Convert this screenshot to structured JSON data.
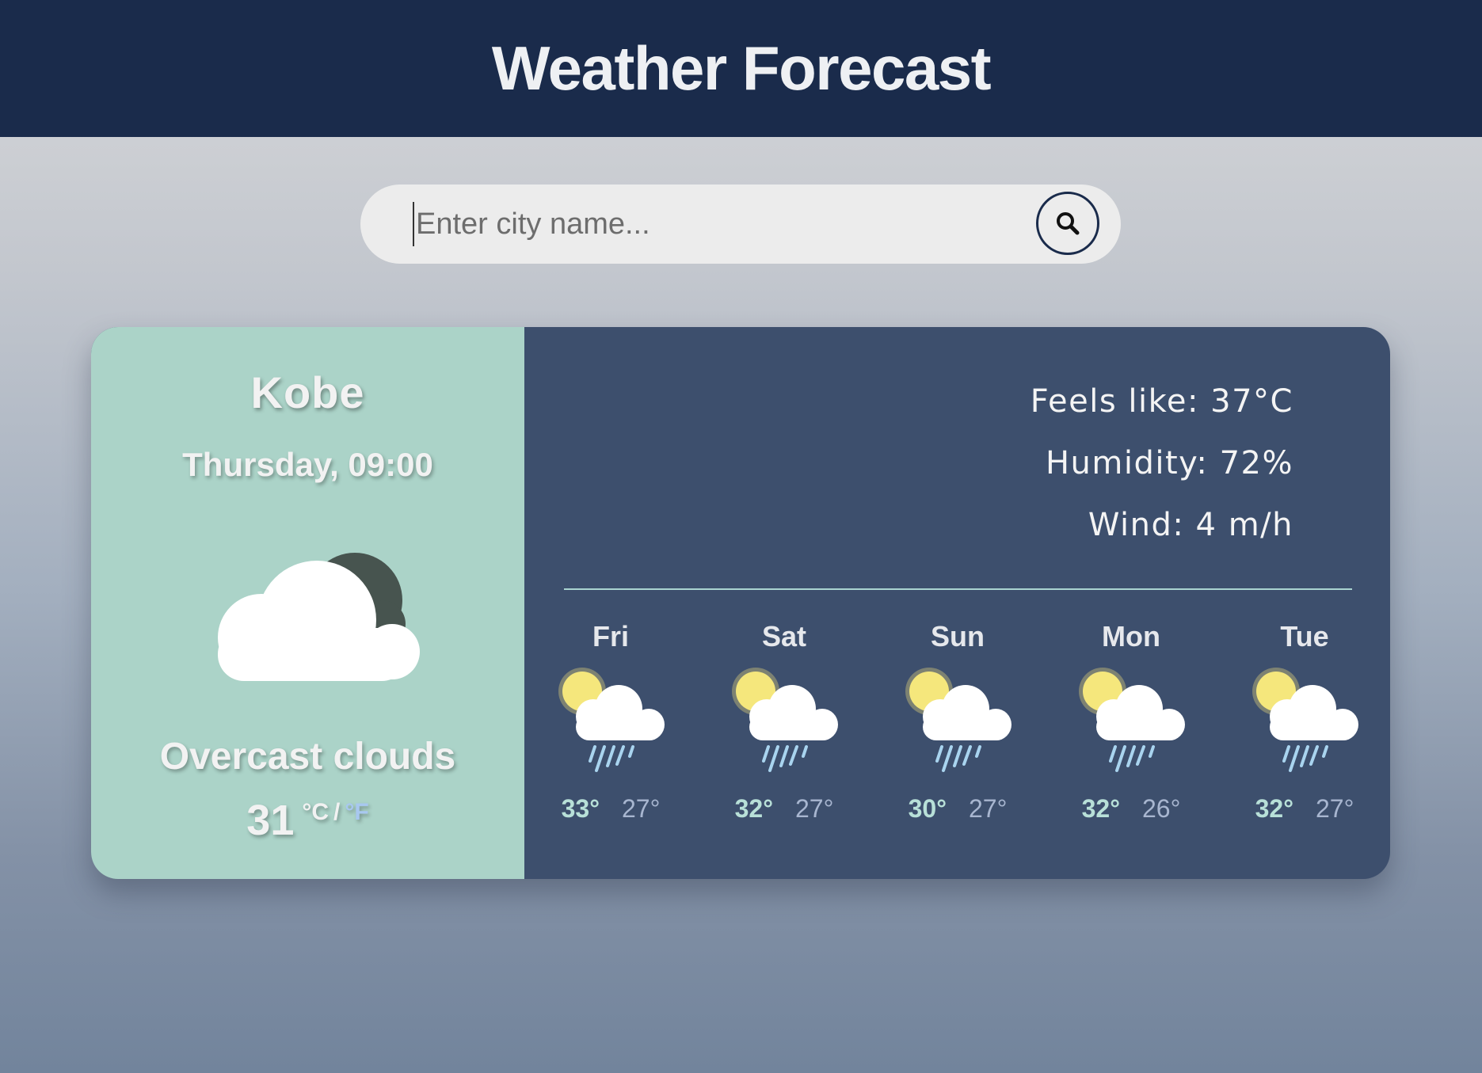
{
  "header": {
    "title": "Weather Forecast"
  },
  "search": {
    "placeholder": "Enter city name...",
    "value": ""
  },
  "current": {
    "city": "Kobe",
    "datetime": "Thursday, 09:00",
    "description": "Overcast clouds",
    "temperature": "31",
    "unit_c": "°C",
    "unit_sep": "/",
    "unit_f": "°F",
    "icon": "overcast-clouds-icon"
  },
  "stats": {
    "feels_like": "Feels like: 37°C",
    "humidity": "Humidity: 72%",
    "wind": "Wind: 4 m/h"
  },
  "forecast": [
    {
      "day": "Fri",
      "max": "33°",
      "min": "27°",
      "icon": "sun-cloud-rain-icon"
    },
    {
      "day": "Sat",
      "max": "32°",
      "min": "27°",
      "icon": "sun-cloud-rain-icon"
    },
    {
      "day": "Sun",
      "max": "30°",
      "min": "27°",
      "icon": "sun-cloud-rain-icon"
    },
    {
      "day": "Mon",
      "max": "32°",
      "min": "26°",
      "icon": "sun-cloud-rain-icon"
    },
    {
      "day": "Tue",
      "max": "32°",
      "min": "27°",
      "icon": "sun-cloud-rain-icon"
    }
  ],
  "colors": {
    "header_bg": "#1a2b4b",
    "left_panel": "#abd3c8",
    "right_panel": "#3d4f6d",
    "accent_f": "#a8c8f0"
  }
}
